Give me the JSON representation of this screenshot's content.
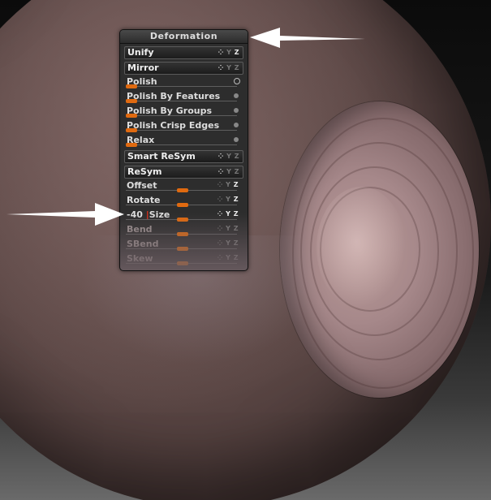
{
  "panel": {
    "title": "Deformation",
    "unify": {
      "label": "Unify",
      "axes": "X Y Z"
    },
    "mirror": {
      "label": "Mirror",
      "axes": "X Y Z"
    },
    "polish": {
      "label": "Polish"
    },
    "polish_by_features": {
      "label": "Polish By Features"
    },
    "polish_by_groups": {
      "label": "Polish By Groups"
    },
    "polish_crisp_edges": {
      "label": "Polish Crisp Edges"
    },
    "relax": {
      "label": "Relax"
    },
    "smart_resym": {
      "label": "Smart ReSym",
      "axes": "X Y Z"
    },
    "resym": {
      "label": "ReSym",
      "axes": "X Y Z"
    },
    "offset": {
      "label": "Offset",
      "axes": "X Y Z"
    },
    "rotate": {
      "label": "Rotate",
      "axes": "X Y Z"
    },
    "size": {
      "label": "-40 Size",
      "value_text": "-40",
      "name_text": "Size",
      "axes": "X Y Z"
    },
    "bend": {
      "label": "Bend",
      "axes": "X Y Z"
    },
    "sbend": {
      "label": "SBend",
      "axes": "X Y Z"
    },
    "skew": {
      "label": "Skew",
      "axes": "X Y Z"
    }
  },
  "colors": {
    "slider_accent": "#e06a10",
    "panel_bg": "#2d2d2d"
  },
  "annotations": {
    "arrow_top": "arrow pointing at Deformation panel title",
    "arrow_left": "arrow pointing at Size slider"
  }
}
